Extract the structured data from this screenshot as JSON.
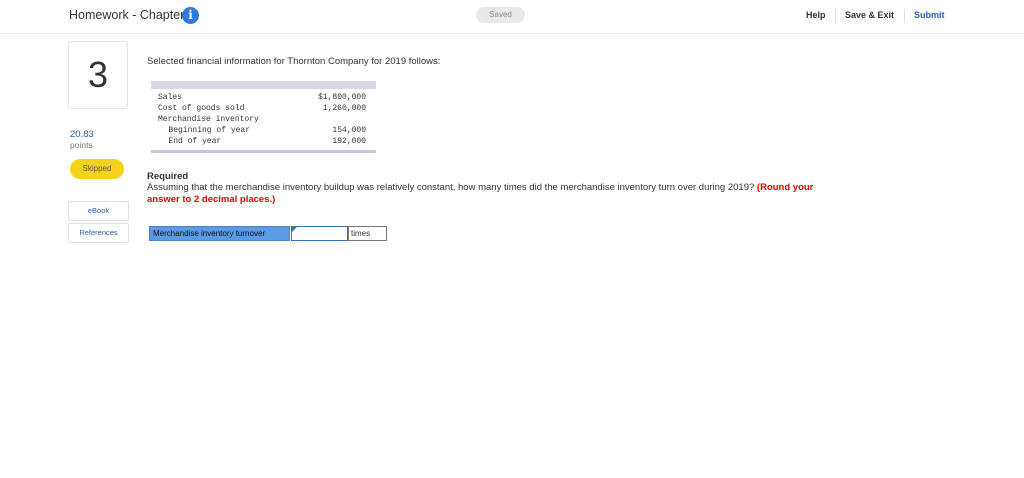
{
  "header": {
    "title": "Homework - Chapter 9",
    "info_icon": "i",
    "status": "Saved",
    "help": "Help",
    "save_exit": "Save & Exit",
    "submit": "Submit"
  },
  "sidebar": {
    "question_number": "3",
    "points_value": "20.83",
    "points_label": "points",
    "status_badge": "Skipped",
    "ebook": "eBook",
    "references": "References"
  },
  "question": {
    "intro": "Selected financial information for Thornton Company for 2019 follows:",
    "table": [
      {
        "label": "Sales",
        "value": "$1,800,000"
      },
      {
        "label": "Cost of goods sold",
        "value": "1,260,000"
      },
      {
        "label": "Merchandise inventory",
        "value": ""
      },
      {
        "label": "   Beginning of year",
        "value": "154,000"
      },
      {
        "label": "   End of year",
        "value": "192,000"
      }
    ],
    "required_heading": "Required",
    "required_text": "Assuming that the merchandise inventory buildup was relatively constant, how many times did the merchandise inventory turn over during 2019?",
    "required_emphasis": "(Round your answer to 2 decimal places.)",
    "answer_label": "Merchandise inventory turnover",
    "answer_value": "",
    "answer_unit": "times"
  },
  "colors": {
    "accent": "#2a62a8",
    "skipped_badge": "#f6d31b",
    "answer_label_bg": "#5a9be3",
    "emphasis": "#e00000"
  }
}
